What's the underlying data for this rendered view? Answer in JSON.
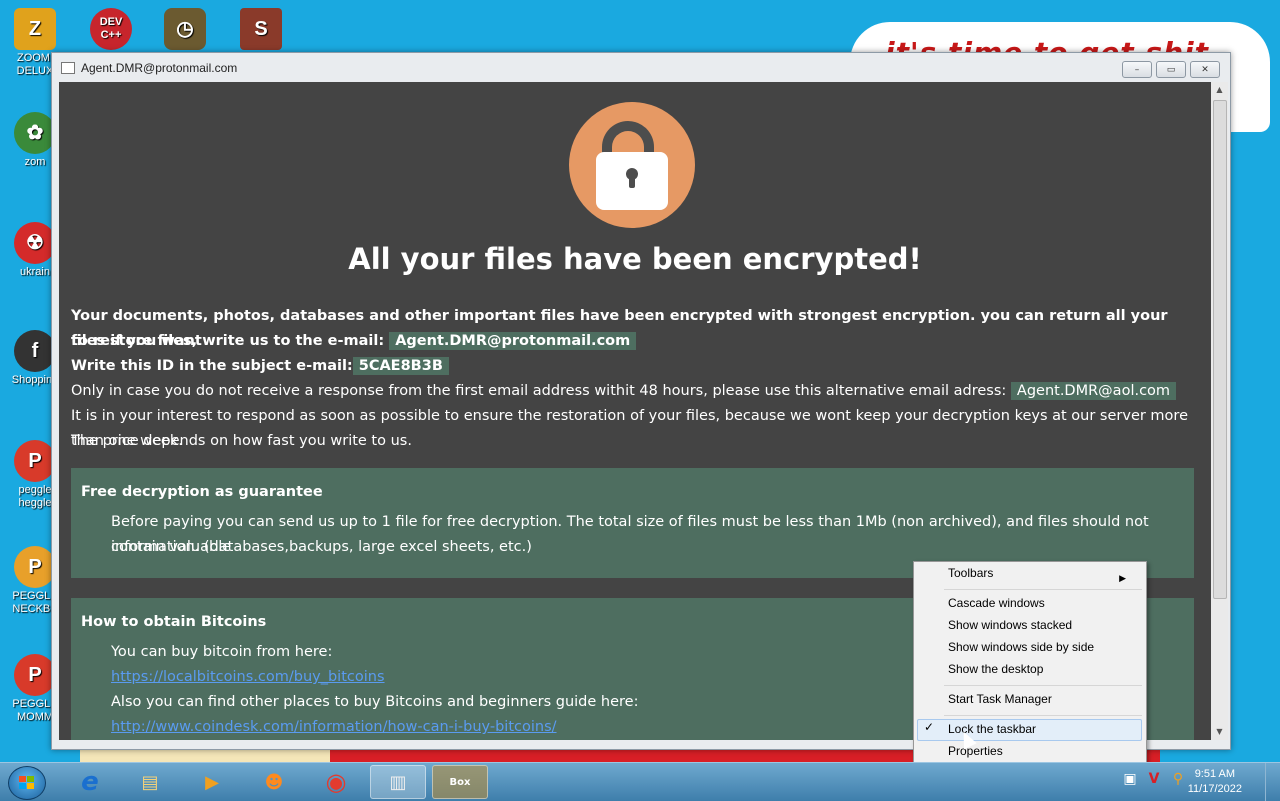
{
  "desktop": {
    "background_text": "it's time to get shit",
    "icons": [
      {
        "label": "ZOOMI DELUX",
        "glyph": "Z",
        "color": "#e0a21c",
        "icon": "zoom-icon"
      },
      {
        "label": "DEV C++",
        "glyph": "DEV",
        "color": "#c7252c",
        "icon": "devcpp-icon"
      },
      {
        "label": "",
        "glyph": "◷",
        "color": "#5a4a2a",
        "icon": "clock-icon"
      },
      {
        "label": "",
        "glyph": "S",
        "color": "#8a3a2a",
        "icon": "seasons-icon"
      },
      {
        "label": "zom",
        "glyph": "✿",
        "color": "#3a8a3a",
        "icon": "flower-icon"
      },
      {
        "label": "ukrain",
        "glyph": "☢",
        "color": "#d42a2a",
        "icon": "radiation-icon"
      },
      {
        "label": "Shopping",
        "glyph": "f",
        "color": "#333",
        "icon": "flash-icon"
      },
      {
        "label": "peggle heggle",
        "glyph": "P",
        "color": "#d83a2a",
        "icon": "peggle-icon"
      },
      {
        "label": "PEGGLE NECKBE",
        "glyph": "P",
        "color": "#e8a02a",
        "icon": "peggle-icon"
      },
      {
        "label": "PEGGLE MOMM",
        "glyph": "P",
        "color": "#d83a2a",
        "icon": "peggle-icon"
      }
    ]
  },
  "window": {
    "title": "Agent.DMR@protonmail.com",
    "minimize": "–",
    "maximize": "▭",
    "close": "✕"
  },
  "note": {
    "headline": "All your files have been encrypted!",
    "line1": "Your documents, photos, databases and other important files have been encrypted with strongest encryption. you can return all your files if you want",
    "line2_prefix": "to restore files, write us to the e-mail:",
    "email_primary": "Agent.DMR@protonmail.com",
    "line3_prefix": "Write this ID in the subject e-mail:",
    "id_code": "5CAE8B3B",
    "line4_prefix": "Only in case you do not receive a response from the first email address withit 48 hours, please use this alternative email adress:",
    "email_alt": "Agent.DMR@aol.com",
    "line5": "It is in your interest to respond as soon as possible to ensure the restoration of your files, because we wont keep your decryption keys at our server more than one week.",
    "line6": "The price depends on how fast you write to us.",
    "guarantee": {
      "title": "Free decryption as guarantee",
      "text1": "Before paying you can send us up to 1 file for free decryption. The total size of files must be less than 1Mb (non archived), and files should not contain valuable",
      "text2": "information. (databases,backups, large excel sheets, etc.)"
    },
    "bitcoins": {
      "title": "How to obtain Bitcoins",
      "text1": "You can buy bitcoin from here:",
      "link1": "https://localbitcoins.com/buy_bitcoins",
      "text2": "Also you can find other places to buy Bitcoins and beginners guide here:",
      "link2": "http://www.coindesk.com/information/how-can-i-buy-bitcoins/"
    }
  },
  "context_menu": {
    "items": [
      {
        "label": "Toolbars",
        "has_submenu": true
      },
      {
        "label": "Cascade windows"
      },
      {
        "label": "Show windows stacked"
      },
      {
        "label": "Show windows side by side"
      },
      {
        "label": "Show the desktop"
      },
      {
        "label": "Start Task Manager"
      },
      {
        "label": "Lock the taskbar",
        "checked": true,
        "hovered": true
      },
      {
        "label": "Properties"
      }
    ]
  },
  "taskbar": {
    "apps": [
      {
        "name": "internet-explorer-icon",
        "glyph": "e"
      },
      {
        "name": "file-explorer-icon",
        "glyph": "▤"
      },
      {
        "name": "media-player-icon",
        "glyph": "▶"
      },
      {
        "name": "uc-browser-icon",
        "glyph": "☻"
      },
      {
        "name": "chrome-icon",
        "glyph": "◉"
      },
      {
        "name": "notepad-icon",
        "glyph": "▥"
      },
      {
        "name": "box-app-icon",
        "glyph": "Box"
      }
    ],
    "clock_time": "9:51 AM",
    "clock_date": "11/17/2022"
  },
  "colors": {
    "desktop_bg": "#1aa9e0",
    "note_bg": "#444444",
    "highlight_box": "#4e6e60",
    "lock_circle": "#e69964"
  }
}
